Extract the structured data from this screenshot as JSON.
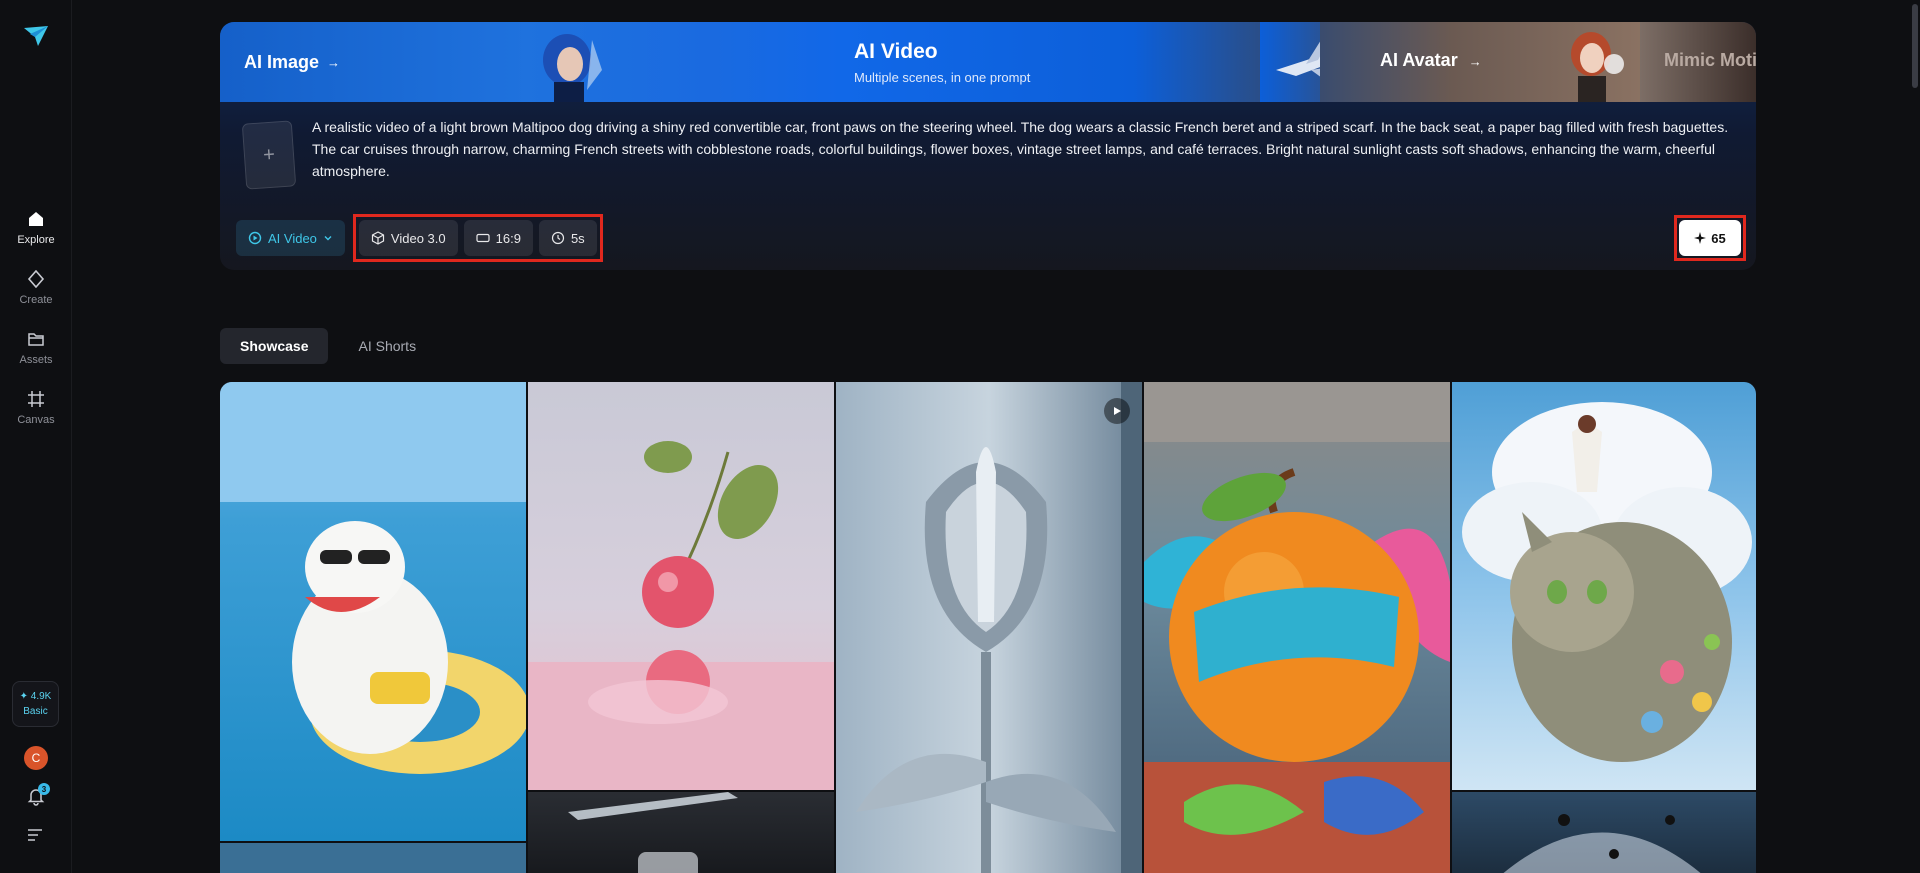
{
  "sidebar": {
    "items": [
      {
        "label": "Explore",
        "icon": "home-icon"
      },
      {
        "label": "Create",
        "icon": "sparkle-diamond-icon"
      },
      {
        "label": "Assets",
        "icon": "folder-icon"
      },
      {
        "label": "Canvas",
        "icon": "canvas-grid-icon"
      }
    ],
    "credits": {
      "amount": "✦ 4.9K",
      "plan": "Basic"
    },
    "avatar_letter": "C",
    "notification_count": "3"
  },
  "hero": {
    "tabs": {
      "ai_image": "AI Image",
      "ai_video_title": "AI Video",
      "ai_video_subtitle": "Multiple scenes, in one prompt",
      "ai_avatar": "AI Avatar",
      "mimic_motion": "Mimic Motion",
      "arrow": "→"
    },
    "upload_plus": "+",
    "prompt": "A realistic video of a light brown Maltipoo dog driving a shiny red convertible car, front paws on the steering wheel. The dog wears a classic French beret and a striped scarf. In the back seat, a paper bag filled with fresh baguettes. The car cruises through narrow, charming French streets with cobblestone roads, colorful buildings, flower boxes, vintage street lamps, and café terraces. Bright natural sunlight casts soft shadows, enhancing the warm, cheerful atmosphere.",
    "mode": "AI Video",
    "options": {
      "model": "Video 3.0",
      "ratio": "16:9",
      "duration": "5s"
    },
    "generate_cost": "65"
  },
  "sub_tabs": {
    "showcase": "Showcase",
    "ai_shorts": "AI Shorts"
  },
  "colors": {
    "accent_cyan": "#3fc7e8",
    "highlight_red": "#e0281e",
    "brand_blue": "#1168e8"
  }
}
